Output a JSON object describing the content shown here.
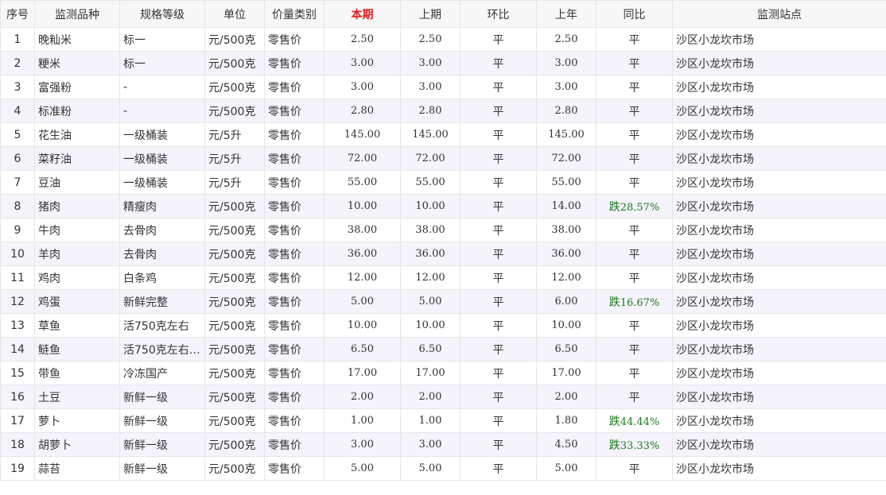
{
  "table": {
    "headers": [
      "序号",
      "监测品种",
      "规格等级",
      "单位",
      "价量类别",
      "本期",
      "上期",
      "环比",
      "上年",
      "同比",
      "监测站点"
    ],
    "current_column_color": "#e02020",
    "down_color": "#1a7a1a",
    "rows": [
      {
        "no": "1",
        "item": "晚籼米",
        "grade": "标一",
        "unit": "元/500克",
        "category": "零售价",
        "current": "2.50",
        "previous": "2.50",
        "mom": "平",
        "last_year": "2.50",
        "yoy_dir": "平",
        "yoy_pct": "",
        "station": "沙区小龙坎市场"
      },
      {
        "no": "2",
        "item": "粳米",
        "grade": "标一",
        "unit": "元/500克",
        "category": "零售价",
        "current": "3.00",
        "previous": "3.00",
        "mom": "平",
        "last_year": "3.00",
        "yoy_dir": "平",
        "yoy_pct": "",
        "station": "沙区小龙坎市场"
      },
      {
        "no": "3",
        "item": "富强粉",
        "grade": "-",
        "unit": "元/500克",
        "category": "零售价",
        "current": "3.00",
        "previous": "3.00",
        "mom": "平",
        "last_year": "3.00",
        "yoy_dir": "平",
        "yoy_pct": "",
        "station": "沙区小龙坎市场"
      },
      {
        "no": "4",
        "item": "标准粉",
        "grade": "-",
        "unit": "元/500克",
        "category": "零售价",
        "current": "2.80",
        "previous": "2.80",
        "mom": "平",
        "last_year": "2.80",
        "yoy_dir": "平",
        "yoy_pct": "",
        "station": "沙区小龙坎市场"
      },
      {
        "no": "5",
        "item": "花生油",
        "grade": "一级桶装",
        "unit": "元/5升",
        "category": "零售价",
        "current": "145.00",
        "previous": "145.00",
        "mom": "平",
        "last_year": "145.00",
        "yoy_dir": "平",
        "yoy_pct": "",
        "station": "沙区小龙坎市场"
      },
      {
        "no": "6",
        "item": "菜籽油",
        "grade": "一级桶装",
        "unit": "元/5升",
        "category": "零售价",
        "current": "72.00",
        "previous": "72.00",
        "mom": "平",
        "last_year": "72.00",
        "yoy_dir": "平",
        "yoy_pct": "",
        "station": "沙区小龙坎市场"
      },
      {
        "no": "7",
        "item": "豆油",
        "grade": "一级桶装",
        "unit": "元/5升",
        "category": "零售价",
        "current": "55.00",
        "previous": "55.00",
        "mom": "平",
        "last_year": "55.00",
        "yoy_dir": "平",
        "yoy_pct": "",
        "station": "沙区小龙坎市场"
      },
      {
        "no": "8",
        "item": "猪肉",
        "grade": "精瘦肉",
        "unit": "元/500克",
        "category": "零售价",
        "current": "10.00",
        "previous": "10.00",
        "mom": "平",
        "last_year": "14.00",
        "yoy_dir": "跌",
        "yoy_pct": "28.57%",
        "station": "沙区小龙坎市场"
      },
      {
        "no": "9",
        "item": "牛肉",
        "grade": "去骨肉",
        "unit": "元/500克",
        "category": "零售价",
        "current": "38.00",
        "previous": "38.00",
        "mom": "平",
        "last_year": "38.00",
        "yoy_dir": "平",
        "yoy_pct": "",
        "station": "沙区小龙坎市场"
      },
      {
        "no": "10",
        "item": "羊肉",
        "grade": "去骨肉",
        "unit": "元/500克",
        "category": "零售价",
        "current": "36.00",
        "previous": "36.00",
        "mom": "平",
        "last_year": "36.00",
        "yoy_dir": "平",
        "yoy_pct": "",
        "station": "沙区小龙坎市场"
      },
      {
        "no": "11",
        "item": "鸡肉",
        "grade": "白条鸡",
        "unit": "元/500克",
        "category": "零售价",
        "current": "12.00",
        "previous": "12.00",
        "mom": "平",
        "last_year": "12.00",
        "yoy_dir": "平",
        "yoy_pct": "",
        "station": "沙区小龙坎市场"
      },
      {
        "no": "12",
        "item": "鸡蛋",
        "grade": "新鲜完整",
        "unit": "元/500克",
        "category": "零售价",
        "current": "5.00",
        "previous": "5.00",
        "mom": "平",
        "last_year": "6.00",
        "yoy_dir": "跌",
        "yoy_pct": "16.67%",
        "station": "沙区小龙坎市场"
      },
      {
        "no": "13",
        "item": "草鱼",
        "grade": "活750克左右",
        "unit": "元/500克",
        "category": "零售价",
        "current": "10.00",
        "previous": "10.00",
        "mom": "平",
        "last_year": "10.00",
        "yoy_dir": "平",
        "yoy_pct": "",
        "station": "沙区小龙坎市场"
      },
      {
        "no": "14",
        "item": "鲢鱼",
        "grade": "活750克左右…",
        "unit": "元/500克",
        "category": "零售价",
        "current": "6.50",
        "previous": "6.50",
        "mom": "平",
        "last_year": "6.50",
        "yoy_dir": "平",
        "yoy_pct": "",
        "station": "沙区小龙坎市场"
      },
      {
        "no": "15",
        "item": "带鱼",
        "grade": "冷冻国产",
        "unit": "元/500克",
        "category": "零售价",
        "current": "17.00",
        "previous": "17.00",
        "mom": "平",
        "last_year": "17.00",
        "yoy_dir": "平",
        "yoy_pct": "",
        "station": "沙区小龙坎市场"
      },
      {
        "no": "16",
        "item": "土豆",
        "grade": "新鲜一级",
        "unit": "元/500克",
        "category": "零售价",
        "current": "2.00",
        "previous": "2.00",
        "mom": "平",
        "last_year": "2.00",
        "yoy_dir": "平",
        "yoy_pct": "",
        "station": "沙区小龙坎市场"
      },
      {
        "no": "17",
        "item": "萝卜",
        "grade": "新鲜一级",
        "unit": "元/500克",
        "category": "零售价",
        "current": "1.00",
        "previous": "1.00",
        "mom": "平",
        "last_year": "1.80",
        "yoy_dir": "跌",
        "yoy_pct": "44.44%",
        "station": "沙区小龙坎市场"
      },
      {
        "no": "18",
        "item": "胡萝卜",
        "grade": "新鲜一级",
        "unit": "元/500克",
        "category": "零售价",
        "current": "3.00",
        "previous": "3.00",
        "mom": "平",
        "last_year": "4.50",
        "yoy_dir": "跌",
        "yoy_pct": "33.33%",
        "station": "沙区小龙坎市场"
      },
      {
        "no": "19",
        "item": "蒜苔",
        "grade": "新鲜一级",
        "unit": "元/500克",
        "category": "零售价",
        "current": "5.00",
        "previous": "5.00",
        "mom": "平",
        "last_year": "5.00",
        "yoy_dir": "平",
        "yoy_pct": "",
        "station": "沙区小龙坎市场"
      }
    ]
  }
}
